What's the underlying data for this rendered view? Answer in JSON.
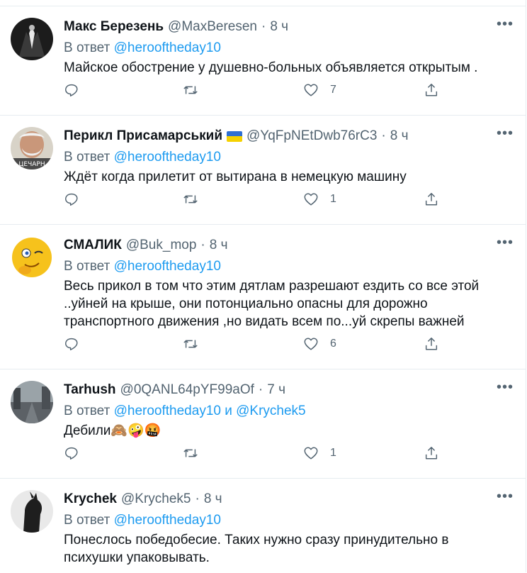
{
  "tweets": [
    {
      "name": "Макс Березень",
      "handle": "@MaxBeresen",
      "time": "8 ч",
      "reply_prefix": "В ответ",
      "reply_to": "@herooftheday10",
      "reply_and": "",
      "reply_to2": "",
      "text": "Майское обострение у душевно-больных объявляется открытым .",
      "likes": "7",
      "flag": false
    },
    {
      "name": "Перикл Присамарський",
      "handle": "@YqFpNEtDwb76rC3",
      "time": "8 ч",
      "reply_prefix": "В ответ",
      "reply_to": "@herooftheday10",
      "reply_and": "",
      "reply_to2": "",
      "text": "Ждёт когда прилетит от вытирана в немецкую машину",
      "likes": "1",
      "flag": true
    },
    {
      "name": "СМАЛИК",
      "handle": "@Buk_mop",
      "time": "8 ч",
      "reply_prefix": "В ответ",
      "reply_to": "@herooftheday10",
      "reply_and": "",
      "reply_to2": "",
      "text": "Весь прикол в том что этим дятлам разрешают ездить со все этой ..уйней на крыше, они потонциально опасны для дорожно транспортного движения ,но видать всем по...уй  скрепы важней",
      "likes": "6",
      "flag": false
    },
    {
      "name": "Tarhush",
      "handle": "@0QANL64pYF99aOf",
      "time": "7 ч",
      "reply_prefix": "В ответ",
      "reply_to": "@herooftheday10",
      "reply_and": "и",
      "reply_to2": "@Krychek5",
      "text": "Дебили🙈🤪🤬",
      "likes": "1",
      "flag": false
    },
    {
      "name": "Krychek",
      "handle": "@Krychek5",
      "time": "8 ч",
      "reply_prefix": "В ответ",
      "reply_to": "@herooftheday10",
      "reply_and": "",
      "reply_to2": "",
      "text": "Понеслось победобесие. Таких нужно сразу принудительно в психушки упаковывать.",
      "likes": "",
      "flag": false
    }
  ],
  "icons": {
    "reply": "reply-icon",
    "retweet": "retweet-icon",
    "like": "heart-icon",
    "share": "share-icon",
    "more": "more-icon"
  },
  "colors": {
    "link": "#1d9bf0",
    "secondary": "#536471",
    "flag_blue": "#2f6fd1",
    "flag_yellow": "#f5d100"
  }
}
